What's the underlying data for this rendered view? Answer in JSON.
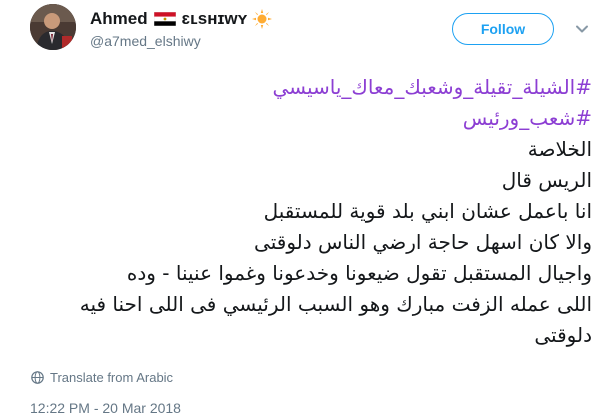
{
  "user": {
    "display_name": "Ahmed",
    "display_name_suffix": "ɛʟsʜɪᴡʏ",
    "handle": "@a7med_elshiwy",
    "flag_icon": "egypt-flag-icon",
    "badge_icon": "sun-icon"
  },
  "follow_button": {
    "label": "Follow"
  },
  "tweet": {
    "lines": [
      "#الشيلة_تقيلة_وشعبك_معاك_ياسيسي",
      "#شعب_ورئيس",
      "الخلاصة",
      "الريس قال",
      "انا باعمل عشان ابني بلد قوية للمستقبل",
      "والا كان اسهل حاجة ارضي الناس دلوقتى",
      "واجيال المستقبل تقول ضيعونا وخدعونا وغموا عنينا - وده",
      "اللى عمله الزفت مبارك وهو السبب الرئيسي فى اللى احنا فيه",
      "دلوقتى"
    ]
  },
  "translate": {
    "label": "Translate from Arabic",
    "icon": "globe-icon"
  },
  "timestamp": "12:22 PM - 20 Mar 2018",
  "colors": {
    "hashtag": "#8c3ed3",
    "follow": "#1da1f2",
    "secondary_text": "#657786",
    "primary_text": "#14171a"
  }
}
